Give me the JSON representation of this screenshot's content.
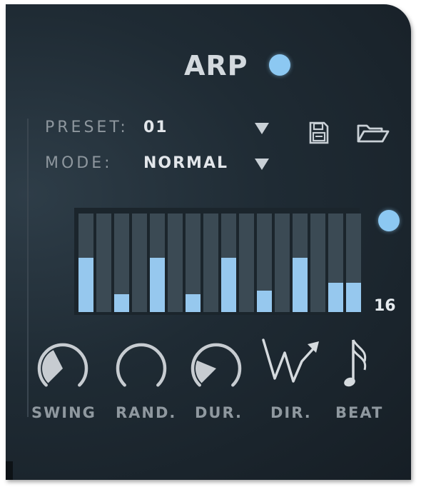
{
  "arp": {
    "title": "ARP",
    "enabled": true,
    "led_color": "#8cc8f2"
  },
  "preset": {
    "label": "PRESET:",
    "value": "01"
  },
  "mode": {
    "label": "MODE:",
    "value": "NORMAL"
  },
  "steps": {
    "count": "16",
    "levels": [
      0.55,
      0,
      0.18,
      0,
      0.55,
      0,
      0.18,
      0,
      0.55,
      0,
      0.22,
      0,
      0.55,
      0,
      0.3,
      0.3
    ]
  },
  "controls": {
    "swing": {
      "label": "SWING",
      "value": 0.4
    },
    "rand": {
      "label": "RAND.",
      "value": 0
    },
    "dur": {
      "label": "DUR.",
      "value": 0.25
    },
    "dir": {
      "label": "DIR.",
      "icon": "zigzag-arrow-icon"
    },
    "beat": {
      "label": "BEAT",
      "icon": "note-icon"
    }
  },
  "colors": {
    "accent": "#8cc8f2",
    "step_fill": "#96c8ee",
    "step_bg": "#3b4a54",
    "panel_bg": "#1f2b34"
  }
}
